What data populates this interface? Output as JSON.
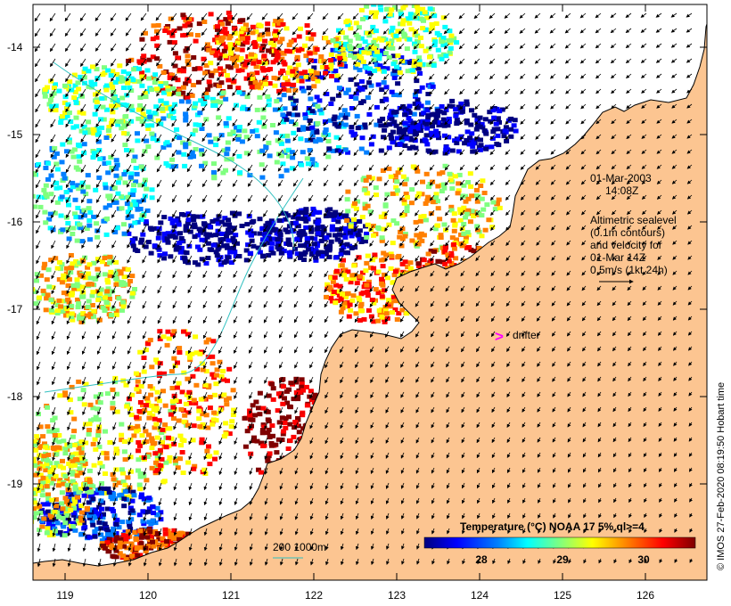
{
  "map": {
    "lat_ticks": [
      "-14",
      "-15",
      "-16",
      "-17",
      "-18",
      "-19"
    ],
    "lon_ticks": [
      "119",
      "120",
      "121",
      "122",
      "123",
      "124",
      "125",
      "126"
    ],
    "date_line1": "01-Mar-2003",
    "date_line2": "14:08Z",
    "info_lines": [
      "Altimetric sealevel",
      "(0.1m contours)",
      "and velocity for",
      "01-Mar 14Z",
      "0.5m/s (1kt 24h)"
    ],
    "drifter_symbol": ">",
    "drifter_label": "drifter",
    "depth_legend": "200  1000m",
    "colorbar_title": "Temperature (°C) NOAA 17 5% ql>=4",
    "colorbar_ticks": [
      "28",
      "29",
      "30"
    ],
    "credit": "© IMOS 27-Feb-2020 08:19:50 Hobart time",
    "colors": {
      "land": "#fcc591",
      "drifter": "#ff00ff",
      "depth_contour": "#30c0c0",
      "colorbar": [
        "#00007f",
        "#0000ff",
        "#007fff",
        "#00ffff",
        "#7fff7f",
        "#ffff00",
        "#ff7f00",
        "#ff0000",
        "#7f0000"
      ]
    }
  }
}
